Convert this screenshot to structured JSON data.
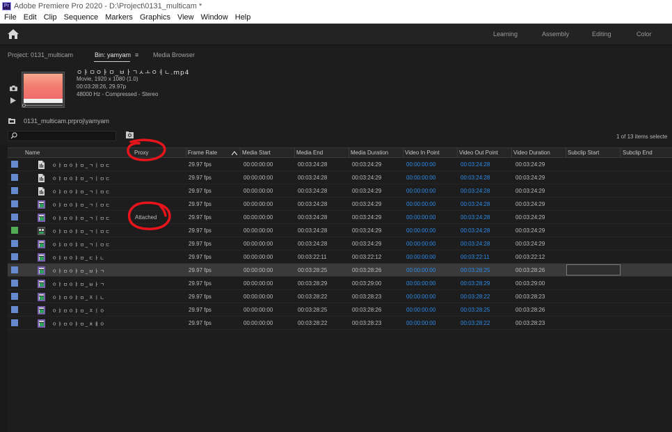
{
  "window": {
    "title": "Adobe Premiere Pro 2020 - D:\\Project\\0131_multicam *",
    "logo": "Pr"
  },
  "menu": [
    "File",
    "Edit",
    "Clip",
    "Sequence",
    "Markers",
    "Graphics",
    "View",
    "Window",
    "Help"
  ],
  "workspaces": [
    "Learning",
    "Assembly",
    "Editing",
    "Color"
  ],
  "panel_tabs": {
    "project": "Project: 0131_multicam",
    "bin": "Bin: yamyam",
    "bin_menu": "≡",
    "media_browser": "Media Browser"
  },
  "preview": {
    "clip_name": "ㅇㅑㅁㅇㅑㅁ_ㅂㅏㄱㅅㅗㅇㅕㄴ.mp4",
    "type": "Movie, 1920 x 1080 (1.0)",
    "duration": "00:03:28:26, 29.97p",
    "audio": "48000 Hz - Compressed - Stereo"
  },
  "path": "0131_multicam.prproj\\yamyam",
  "search": {
    "placeholder": "",
    "items_count": "1 of 13 items selecte"
  },
  "columns": [
    "Name",
    "Proxy",
    "Frame Rate",
    "Media Start",
    "Media End",
    "Media Duration",
    "Video In Point",
    "Video Out Point",
    "Video Duration",
    "Subclip Start",
    "Subclip End"
  ],
  "rows": [
    {
      "color": "#6688cc",
      "icon": "audio-file-icon",
      "name": "ㅇㅑㅁㅇㅑㅁ_ㄱㅣㅁㄷ",
      "proxy": "",
      "fr": "29.97 fps",
      "ms": "00:00:00:00",
      "me": "00:03:24:28",
      "md": "00:03:24:29",
      "vin": "00:00:00:00",
      "vout": "00:03:24:28",
      "vd": "00:03:24:29",
      "selected": false
    },
    {
      "color": "#6688cc",
      "icon": "audio-file-icon",
      "name": "ㅇㅑㅁㅇㅑㅁ_ㄱㅣㅁㄷ",
      "proxy": "",
      "fr": "29.97 fps",
      "ms": "00:00:00:00",
      "me": "00:03:24:28",
      "md": "00:03:24:29",
      "vin": "00:00:00:00",
      "vout": "00:03:24:28",
      "vd": "00:03:24:29",
      "selected": false
    },
    {
      "color": "#6688cc",
      "icon": "audio-file-icon",
      "name": "ㅇㅑㅁㅇㅑㅁ_ㄱㅣㅁㄷ",
      "proxy": "",
      "fr": "29.97 fps",
      "ms": "00:00:00:00",
      "me": "00:03:24:28",
      "md": "00:03:24:29",
      "vin": "00:00:00:00",
      "vout": "00:03:24:28",
      "vd": "00:03:24:29",
      "selected": false
    },
    {
      "color": "#6688cc",
      "icon": "video-clip-icon",
      "name": "ㅇㅑㅁㅇㅑㅁ_ㄱㅣㅁㄷ",
      "proxy": "",
      "fr": "29.97 fps",
      "ms": "00:00:00:00",
      "me": "00:03:24:28",
      "md": "00:03:24:29",
      "vin": "00:00:00:00",
      "vout": "00:03:24:28",
      "vd": "00:03:24:29",
      "selected": false
    },
    {
      "color": "#6688cc",
      "icon": "video-clip-icon",
      "name": "ㅇㅑㅁㅇㅑㅁ_ㄱㅣㅁㄷ",
      "proxy": "Attached",
      "fr": "29.97 fps",
      "ms": "00:00:00:00",
      "me": "00:03:24:28",
      "md": "00:03:24:29",
      "vin": "00:00:00:00",
      "vout": "00:03:24:28",
      "vd": "00:03:24:29",
      "selected": false
    },
    {
      "color": "#55aa55",
      "icon": "multicam-icon",
      "name": "ㅇㅑㅁㅇㅑㅁ_ㄱㅣㅁㄷ",
      "proxy": "",
      "fr": "29.97 fps",
      "ms": "00:00:00:00",
      "me": "00:03:24:28",
      "md": "00:03:24:29",
      "vin": "00:00:00:00",
      "vout": "00:03:24:28",
      "vd": "00:03:24:29",
      "selected": false
    },
    {
      "color": "#6688cc",
      "icon": "video-clip-icon",
      "name": "ㅇㅑㅁㅇㅑㅁ_ㄱㅣㅁㄷ",
      "proxy": "",
      "fr": "29.97 fps",
      "ms": "00:00:00:00",
      "me": "00:03:24:28",
      "md": "00:03:24:29",
      "vin": "00:00:00:00",
      "vout": "00:03:24:28",
      "vd": "00:03:24:29",
      "selected": false
    },
    {
      "color": "#6688cc",
      "icon": "video-clip-icon",
      "name": "ㅇㅑㅁㅇㅑㅁ_ㄷㅏㄴ",
      "proxy": "",
      "fr": "29.97 fps",
      "ms": "00:00:00:00",
      "me": "00:03:22:11",
      "md": "00:03:22:12",
      "vin": "00:00:00:00",
      "vout": "00:03:22:11",
      "vd": "00:03:22:12",
      "selected": false
    },
    {
      "color": "#6688cc",
      "icon": "video-clip-icon",
      "name": "ㅇㅑㅁㅇㅑㅁ_ㅂㅏㄱ",
      "proxy": "",
      "fr": "29.97 fps",
      "ms": "00:00:00:00",
      "me": "00:03:28:25",
      "md": "00:03:28:26",
      "vin": "00:00:00:00",
      "vout": "00:03:28:25",
      "vd": "00:03:28:26",
      "selected": true
    },
    {
      "color": "#6688cc",
      "icon": "video-clip-icon",
      "name": "ㅇㅑㅁㅇㅑㅁ_ㅂㅏㄱ",
      "proxy": "",
      "fr": "29.97 fps",
      "ms": "00:00:00:00",
      "me": "00:03:28:29",
      "md": "00:03:29:00",
      "vin": "00:00:00:00",
      "vout": "00:03:28:29",
      "vd": "00:03:29:00",
      "selected": false
    },
    {
      "color": "#6688cc",
      "icon": "video-clip-icon",
      "name": "ㅇㅑㅁㅇㅑㅁ_ㅈㅣㄴ",
      "proxy": "",
      "fr": "29.97 fps",
      "ms": "00:00:00:00",
      "me": "00:03:28:22",
      "md": "00:03:28:23",
      "vin": "00:00:00:00",
      "vout": "00:03:28:22",
      "vd": "00:03:28:23",
      "selected": false
    },
    {
      "color": "#6688cc",
      "icon": "video-clip-icon",
      "name": "ㅇㅑㅁㅇㅑㅁ_ㅈㅣㅇ",
      "proxy": "",
      "fr": "29.97 fps",
      "ms": "00:00:00:00",
      "me": "00:03:28:25",
      "md": "00:03:28:26",
      "vin": "00:00:00:00",
      "vout": "00:03:28:25",
      "vd": "00:03:28:26",
      "selected": false
    },
    {
      "color": "#6688cc",
      "icon": "video-clip-icon",
      "name": "ㅇㅑㅁㅇㅑㅁ_ㅊㅐㅇ",
      "proxy": "",
      "fr": "29.97 fps",
      "ms": "00:00:00:00",
      "me": "00:03:28:22",
      "md": "00:03:28:23",
      "vin": "00:00:00:00",
      "vout": "00:03:28:22",
      "vd": "00:03:28:23",
      "selected": false
    }
  ],
  "colors": {
    "accent_blue": "#2d8ceb",
    "annotation_red": "#e8141c",
    "label_blue": "#6688cc",
    "label_green": "#55aa55"
  }
}
